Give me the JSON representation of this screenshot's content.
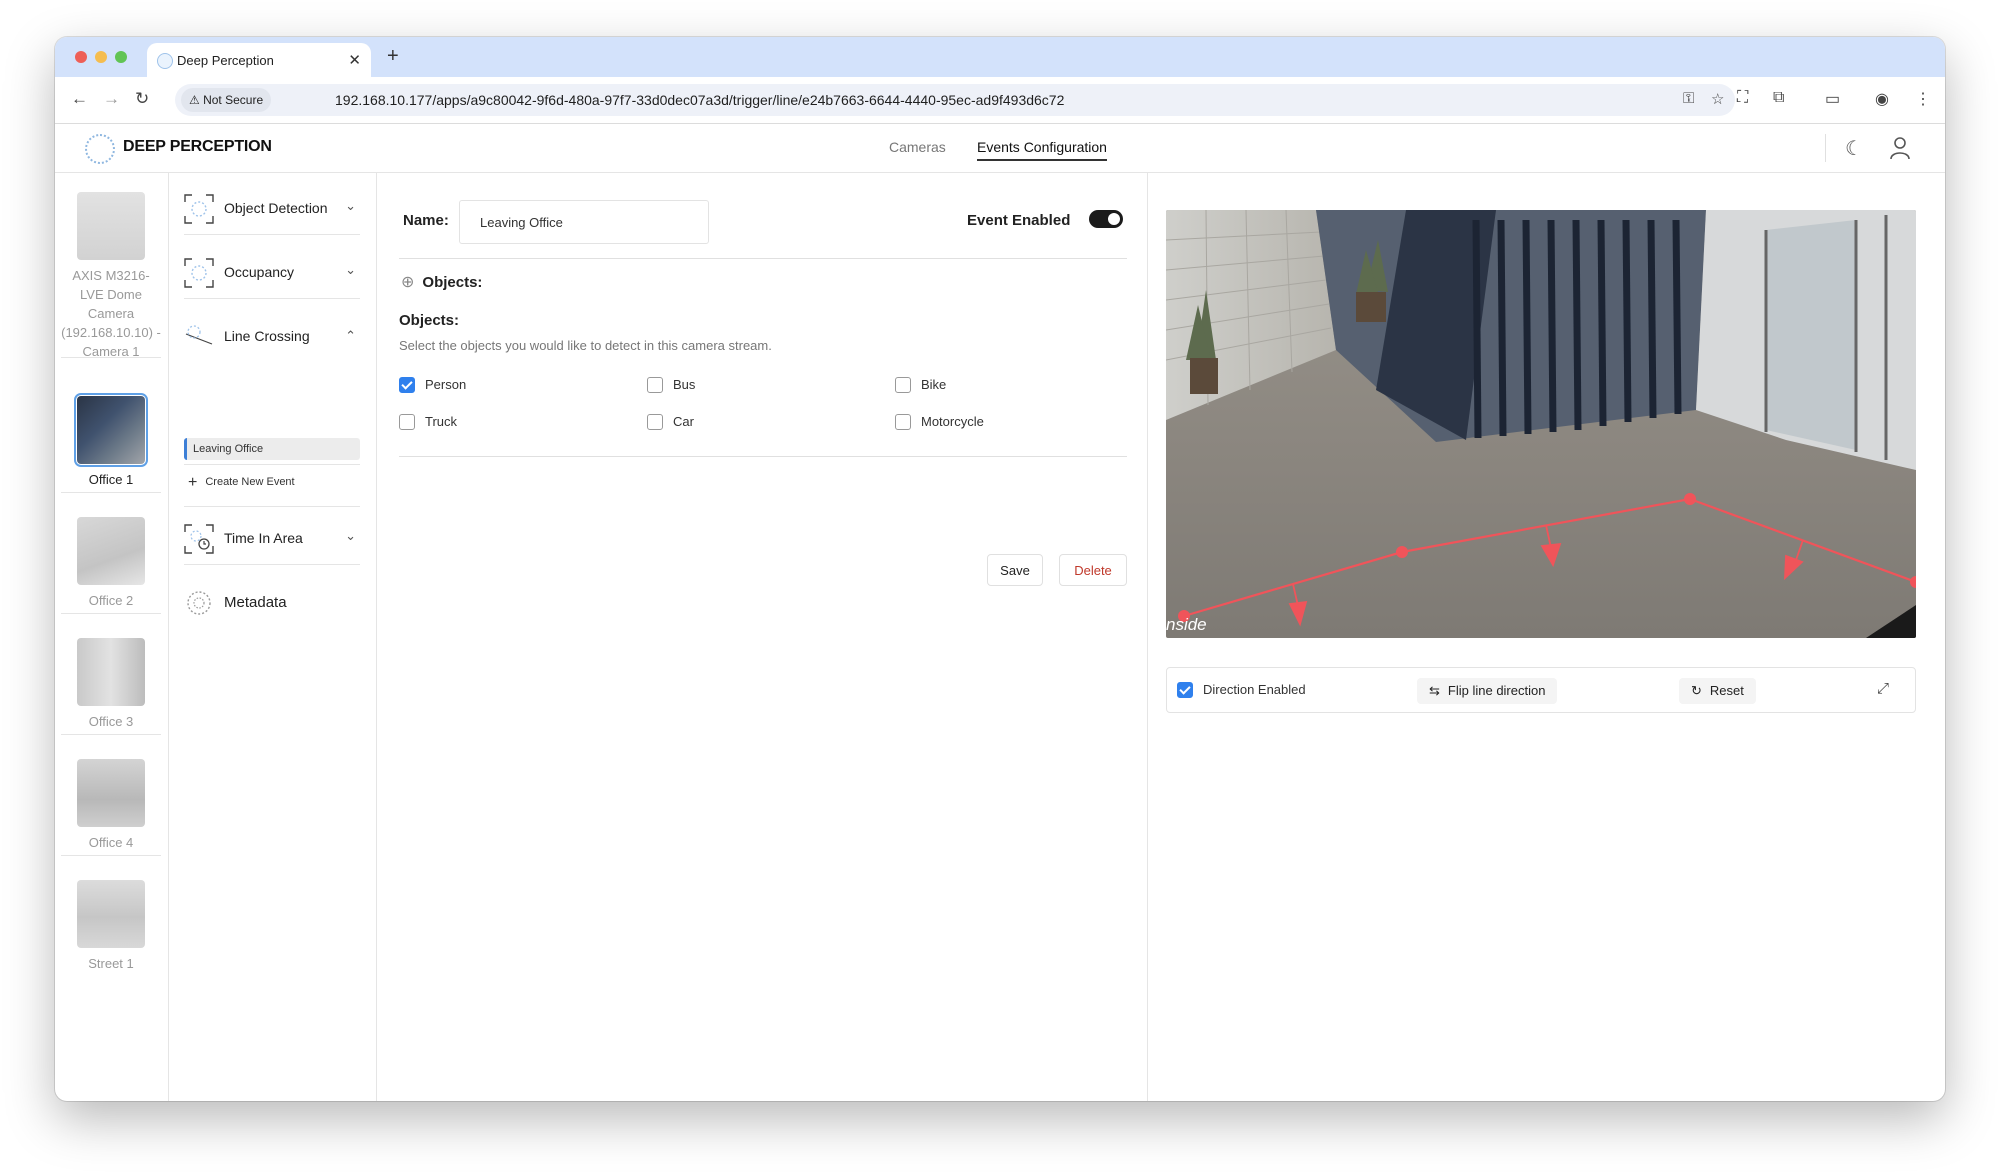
{
  "browser": {
    "tab_title": "Deep Perception",
    "security_label": "Not Secure",
    "url": "192.168.10.177/apps/a9c80042-9f6d-480a-97f7-33d0dec07a3d/trigger/line/e24b7663-6644-4440-95ec-ad9f493d6c72"
  },
  "header": {
    "brand": "DEEP PERCEPTION",
    "nav": [
      "Cameras",
      "Events Configuration"
    ],
    "active_nav": "Events Configuration"
  },
  "cameras": [
    {
      "label": "AXIS M3216-LVE Dome Camera (192.168.10.10) - Camera 1",
      "selected": false
    },
    {
      "label": "Office 1",
      "selected": true
    },
    {
      "label": "Office 2",
      "selected": false
    },
    {
      "label": "Office 3",
      "selected": false
    },
    {
      "label": "Office 4",
      "selected": false
    },
    {
      "label": "Street 1",
      "selected": false
    }
  ],
  "event_types": [
    {
      "label": "Object Detection",
      "icon": "object-detection-icon",
      "expanded": false
    },
    {
      "label": "Occupancy",
      "icon": "occupancy-icon",
      "expanded": false
    },
    {
      "label": "Line Crossing",
      "icon": "line-crossing-icon",
      "expanded": true
    },
    {
      "label": "Time In Area",
      "icon": "time-in-area-icon",
      "expanded": false
    },
    {
      "label": "Metadata",
      "icon": "metadata-icon",
      "expanded": false
    }
  ],
  "line_crossing_events": [
    "Leaving Office"
  ],
  "create_new_label": "Create New Event",
  "form": {
    "name_label": "Name:",
    "name_value": "Leaving Office",
    "event_enabled_label": "Event Enabled",
    "event_enabled": true,
    "add_objects_label": "Objects:",
    "objects_title": "Objects:",
    "objects_desc": "Select the objects you would like to detect in this camera stream.",
    "objects": [
      {
        "label": "Person",
        "checked": true
      },
      {
        "label": "Bus",
        "checked": false
      },
      {
        "label": "Bike",
        "checked": false
      },
      {
        "label": "Truck",
        "checked": false
      },
      {
        "label": "Car",
        "checked": false
      },
      {
        "label": "Motorcycle",
        "checked": false
      }
    ],
    "save_label": "Save",
    "delete_label": "Delete"
  },
  "preview": {
    "overlay_text": "nside",
    "line_color": "#f0545a"
  },
  "controls": {
    "direction_enabled_label": "Direction Enabled",
    "direction_enabled": true,
    "flip_label": "Flip line direction",
    "reset_label": "Reset"
  },
  "colors": {
    "accent": "#2f80ed",
    "delete": "#c0392b",
    "tabbar": "#d3e2fb"
  }
}
